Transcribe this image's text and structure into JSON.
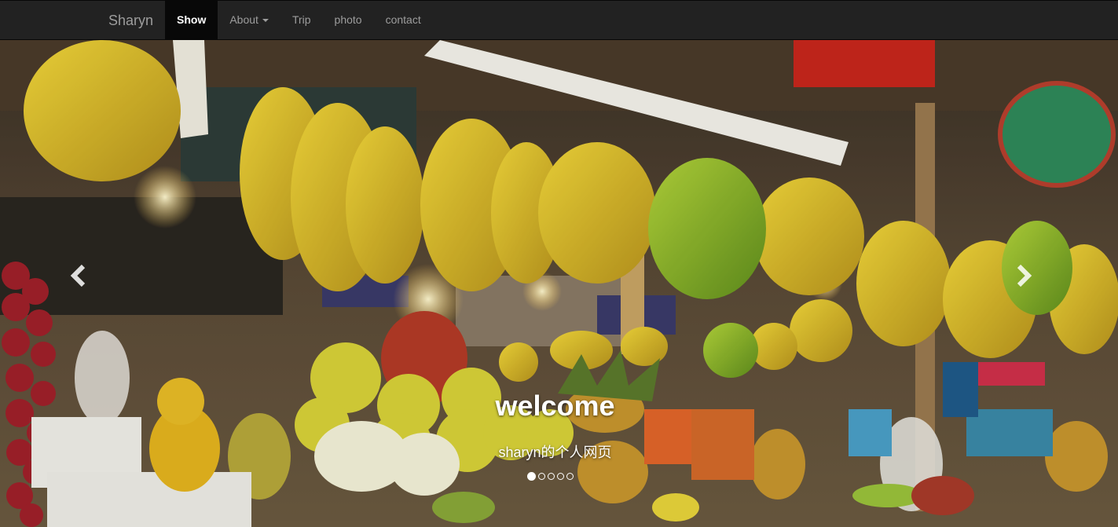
{
  "navbar": {
    "brand": "Sharyn",
    "items": [
      {
        "label": "Show",
        "active": true
      },
      {
        "label": "About",
        "dropdown": true
      },
      {
        "label": "Trip"
      },
      {
        "label": "photo"
      },
      {
        "label": "contact"
      }
    ]
  },
  "carousel": {
    "caption_title": "welcome",
    "caption_subtitle": "sharyn的个人网页",
    "indicator_count": 5,
    "active_index": 0,
    "prev_icon": "chevron-left-icon",
    "next_icon": "chevron-right-icon"
  },
  "colors": {
    "navbar_bg": "#222222",
    "nav_text": "#9d9d9d",
    "active_bg": "#080808"
  }
}
